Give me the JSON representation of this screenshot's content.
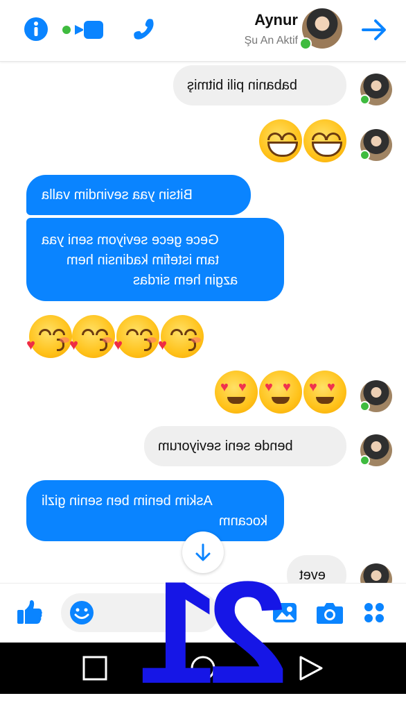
{
  "header": {
    "contact_name": "Aynur",
    "contact_status": "Şu An Aktif",
    "icons": [
      "info-icon",
      "video-call-icon",
      "phone-icon",
      "avatar",
      "forward-arrow-icon"
    ]
  },
  "messages": [
    {
      "type": "text",
      "side": "incoming",
      "text": "babanin pili bitmiş"
    },
    {
      "type": "emoji",
      "side": "incoming",
      "emoji": "grinning-face",
      "count": 2
    },
    {
      "type": "text",
      "side": "outgoing",
      "text": "Bitsin yaa sevindim valla"
    },
    {
      "type": "text",
      "side": "outgoing",
      "lines": [
        "Gece gece seviyom seni yaa",
        "tam istefim kadinsin hem",
        "azgin hem sirdas"
      ]
    },
    {
      "type": "emoji",
      "side": "outgoing",
      "emoji": "face-blowing-kiss",
      "count": 4
    },
    {
      "type": "emoji",
      "side": "incoming",
      "emoji": "heart-eyes",
      "count": 3
    },
    {
      "type": "text",
      "side": "incoming",
      "text": "bende seni seviyorum"
    },
    {
      "type": "text",
      "side": "outgoing",
      "lines": [
        "Askim benim ben senin gizli",
        "kocanm"
      ]
    },
    {
      "type": "text",
      "side": "incoming",
      "text": "evet"
    }
  ],
  "composer": {
    "icons": [
      "like-icon",
      "emoji-icon",
      "gallery-icon",
      "camera-icon",
      "more-apps-icon"
    ]
  },
  "navbar": {
    "icons": [
      "recent-apps-icon",
      "home-icon",
      "back-icon"
    ]
  },
  "overlay": {
    "number": "21"
  },
  "colors": {
    "accent": "#0a84ff",
    "incoming_bubble": "#efefef",
    "online": "#3fbb3f",
    "overlay": "#1616e6"
  }
}
